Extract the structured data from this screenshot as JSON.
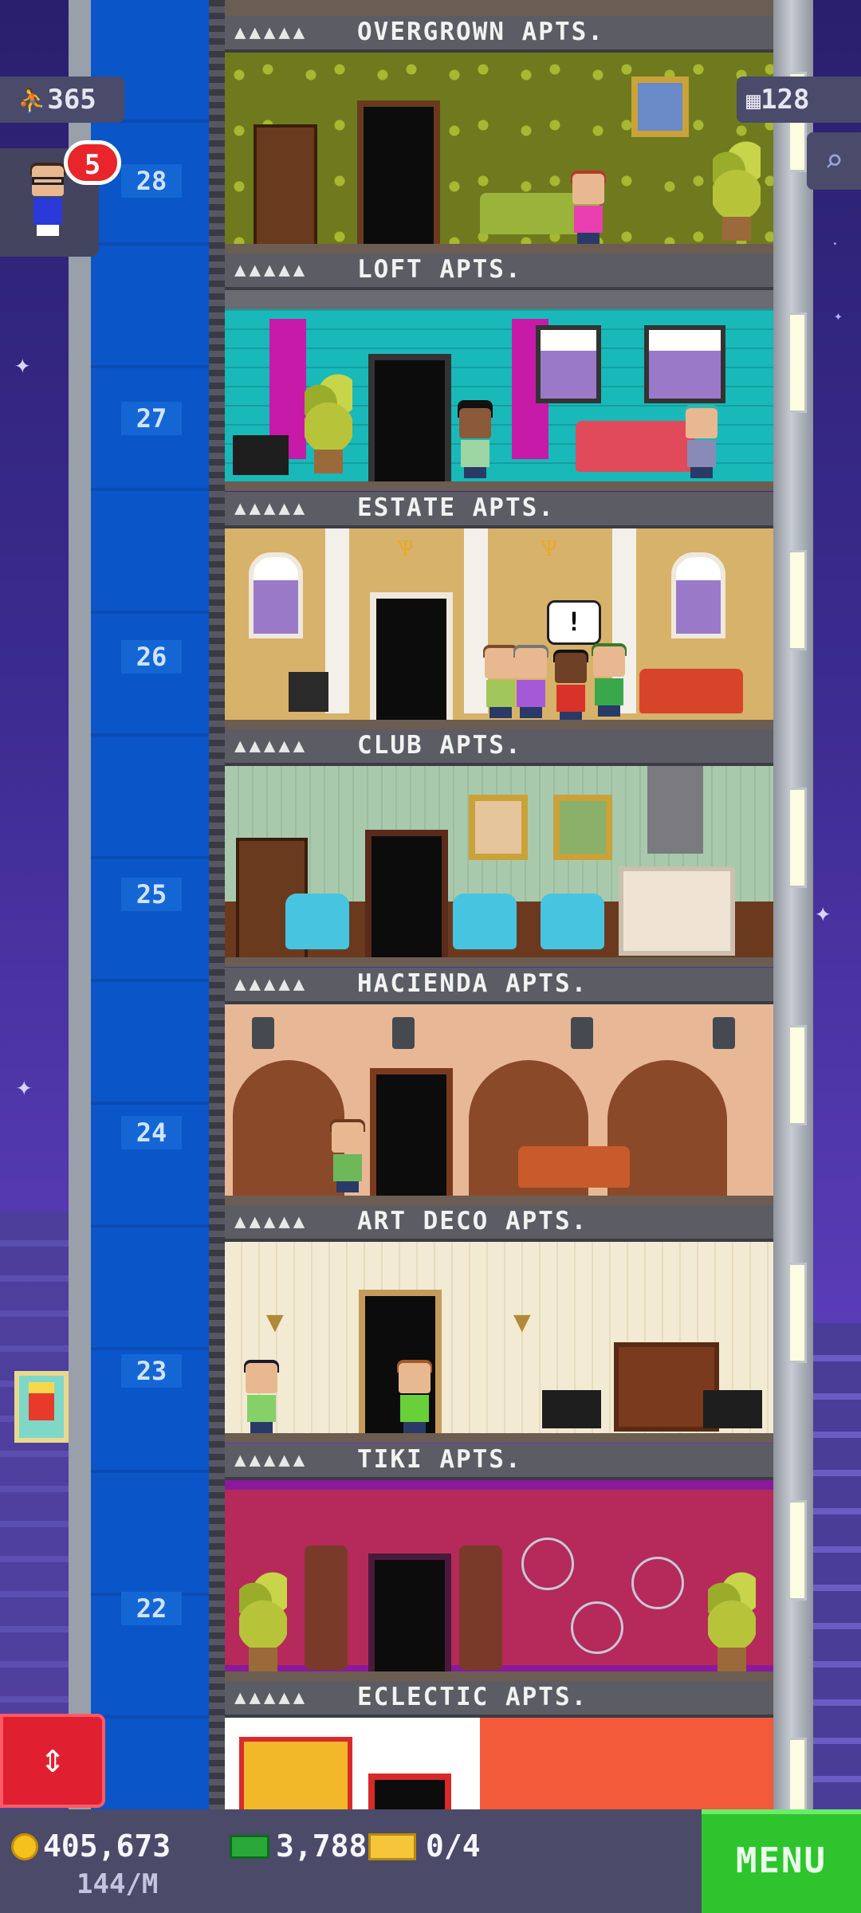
{
  "hud": {
    "population": "365",
    "floors": "128",
    "notification_count": "5"
  },
  "floors": [
    {
      "number": "28",
      "name": "OVERGROWN APTS.",
      "stars": "▲▲▲▲▲"
    },
    {
      "number": "27",
      "name": "LOFT APTS.",
      "stars": "▲▲▲▲▲"
    },
    {
      "number": "26",
      "name": "ESTATE APTS.",
      "stars": "▲▲▲▲▲"
    },
    {
      "number": "25",
      "name": "CLUB APTS.",
      "stars": "▲▲▲▲▲"
    },
    {
      "number": "24",
      "name": "HACIENDA APTS.",
      "stars": "▲▲▲▲▲"
    },
    {
      "number": "23",
      "name": "ART DECO APTS.",
      "stars": "▲▲▲▲▲"
    },
    {
      "number": "22",
      "name": "TIKI APTS.",
      "stars": "▲▲▲▲▲"
    },
    {
      "number": "",
      "name": "ECLECTIC APTS.",
      "stars": "▲▲▲▲▲"
    }
  ],
  "speech_bubble": "!",
  "bottom": {
    "coins": "405,673",
    "coin_rate": "144/M",
    "bux": "3,788",
    "tickets": "0/4",
    "menu_label": "MENU"
  },
  "icons": {
    "population": "person-icon",
    "floors": "building-icon",
    "search": "magnifier-icon",
    "elevator": "up-down-arrows-icon",
    "coin": "coin-icon",
    "bux": "bux-icon",
    "ticket": "ticket-icon"
  },
  "colors": {
    "shaft": "#0a55c8",
    "menu": "#2ec42e",
    "notification": "#e8252a",
    "elevator_button": "#e02030"
  }
}
